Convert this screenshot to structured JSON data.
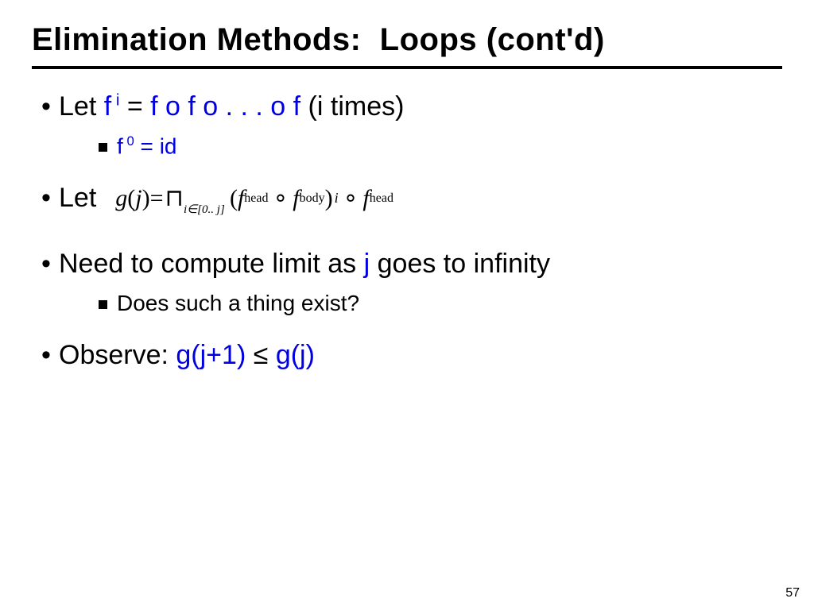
{
  "title": "Elimination Methods:  Loops (cont'd)",
  "b1": {
    "let": "Let ",
    "f": "f",
    "sup_i": " i",
    "eq": " = ",
    "rhs": "f o f o . . . o f   ",
    "tail": "(i times)"
  },
  "b1sub": {
    "f": "f",
    "sup0": " 0",
    "eq": " = id"
  },
  "b2": {
    "let": "Let"
  },
  "formula": {
    "g": "g",
    "lp": "(",
    "j": "j",
    "rp": ")",
    "eq": " = ",
    "cap": "⊓",
    "sub": "i∈[0.. j]",
    "lp2": "(",
    "fhead": "f",
    "head_sub": "head",
    "circ": "∘",
    "fbody": "f",
    "body_sub": "body",
    "rp2": ")",
    "sup_i": "i",
    "fhead2": "f",
    "head_sub2": "head"
  },
  "b3": {
    "pre": "Need to compute limit as ",
    "j": "j",
    "post": " goes to infinity"
  },
  "b3sub": "Does such a thing exist?",
  "b4": {
    "pre": "Observe:  ",
    "lhs": "g(j+1)",
    "le": " ≤ ",
    "rhs": "g(j)"
  },
  "pagenum": "57"
}
